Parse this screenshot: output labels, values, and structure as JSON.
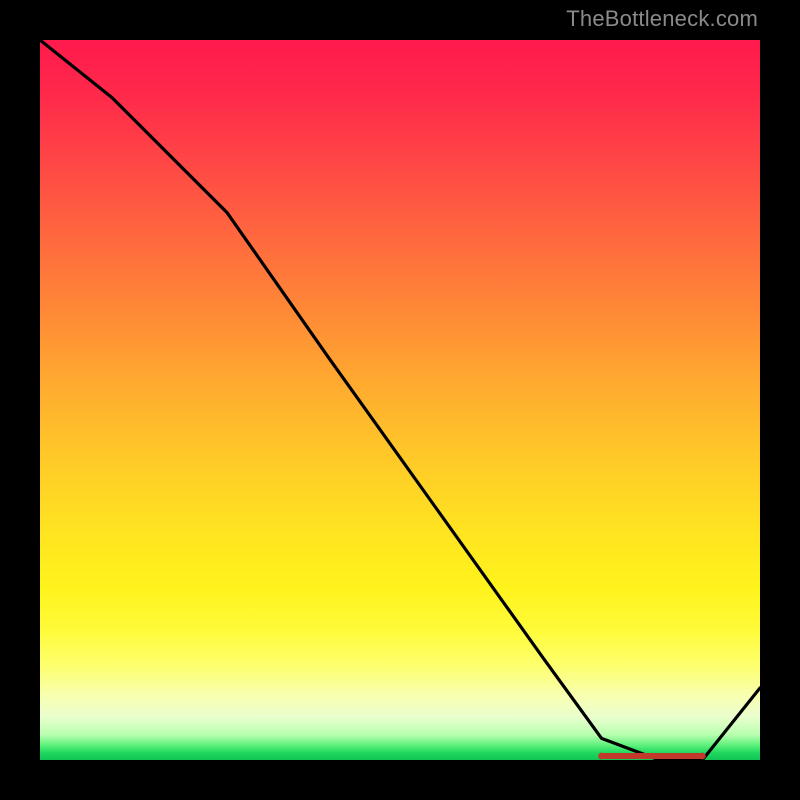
{
  "watermark": "TheBottleneck.com",
  "colors": {
    "frame": "#000000",
    "curve": "#000000",
    "marker": "#c0392b",
    "gradient_top": "#ff1a4d",
    "gradient_bottom": "#11c455"
  },
  "chart_data": {
    "type": "line",
    "title": "",
    "xlabel": "",
    "ylabel": "",
    "xlim": [
      0,
      1
    ],
    "ylim": [
      0,
      1
    ],
    "x": [
      0.0,
      0.1,
      0.2,
      0.26,
      0.4,
      0.55,
      0.7,
      0.78,
      0.86,
      0.92,
      1.0
    ],
    "values": [
      1.0,
      0.92,
      0.82,
      0.76,
      0.56,
      0.35,
      0.14,
      0.03,
      0.0,
      0.0,
      0.1
    ],
    "annotations": [
      {
        "kind": "flat-minimum-marker",
        "x_start": 0.78,
        "x_end": 0.92,
        "y": 0.0
      }
    ],
    "description": "Single black curve descending from top-left, inflecting near x≈0.26, reaching a flat minimum over x≈0.78–0.92 at y≈0, then rising toward the right edge. Background is a vertical heat gradient (red→yellow→green). A short red horizontal marker with endpoint dots highlights the flat minimum."
  }
}
